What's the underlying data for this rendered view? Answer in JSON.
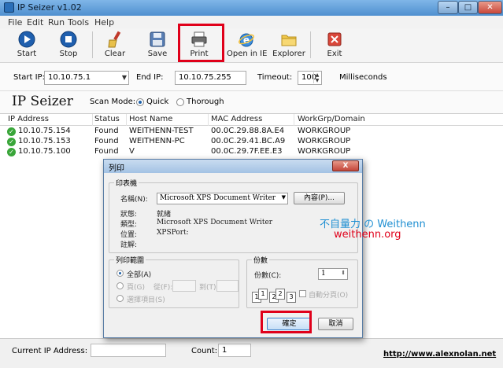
{
  "window": {
    "title": "IP Seizer v1.02",
    "min": "–",
    "max": "□",
    "close": "✕"
  },
  "menu": [
    "File",
    "Edit",
    "Run",
    "Tools",
    "Help"
  ],
  "toolbar": {
    "start": "Start",
    "stop": "Stop",
    "clear": "Clear",
    "save": "Save",
    "print": "Print",
    "open_ie": "Open in IE",
    "explorer": "Explorer",
    "exit": "Exit"
  },
  "iprow": {
    "start_ip_label": "Start IP:",
    "start_ip": "10.10.75.1",
    "end_ip_label": "End IP:",
    "end_ip": "10.10.75.255",
    "timeout_label": "Timeout:",
    "timeout": "100",
    "timeout_unit": "Milliseconds"
  },
  "header": {
    "brand": "IP Seizer",
    "scan_mode_label": "Scan Mode:",
    "quick": "Quick",
    "thorough": "Thorough"
  },
  "table": {
    "columns": [
      "IP Address",
      "Status",
      "Host Name",
      "MAC Address",
      "WorkGrp/Domain"
    ],
    "rows": [
      [
        "10.10.75.154",
        "Found",
        "WEITHENN-TEST",
        "00.0C.29.88.8A.E4",
        "WORKGROUP"
      ],
      [
        "10.10.75.153",
        "Found",
        "WEITHENN-PC",
        "00.0C.29.41.BC.A9",
        "WORKGROUP"
      ],
      [
        "10.10.75.100",
        "Found",
        "V",
        "00.0C.29.7F.EE.E3",
        "WORKGROUP"
      ]
    ]
  },
  "status": {
    "current_ip_label": "Current IP Address:",
    "current_ip": "",
    "count_label": "Count:",
    "count": "1",
    "site": "http://www.alexnolan.net"
  },
  "dialog": {
    "title": "列印",
    "close": "X",
    "printer_group": "印表機",
    "name_label": "名稱(N):",
    "name_value": "Microsoft XPS Document Writer",
    "properties_btn": "內容(P)...",
    "status_label": "狀態:",
    "status_value": "就緒",
    "type_label": "類型:",
    "type_value": "Microsoft XPS Document Writer",
    "where_label": "位置:",
    "where_value": "XPSPort:",
    "comment_label": "註解:",
    "range_group": "列印範圍",
    "all": "全部(A)",
    "pages": "頁(G)",
    "from": "從(F):",
    "to": "到(T):",
    "selection": "選擇項目(S)",
    "copies_group": "份數",
    "copies_label": "份數(C):",
    "copies_value": "1",
    "collate": "自動分頁(O)",
    "ok": "確定",
    "cancel": "取消"
  },
  "watermark": {
    "line1": "不自量力 の Weithenn",
    "line2": "weithenn.org"
  },
  "colors": {
    "highlight": "#e0001a",
    "titlebar": "#4f8fcf",
    "ok_icon": "#3aa63a"
  }
}
